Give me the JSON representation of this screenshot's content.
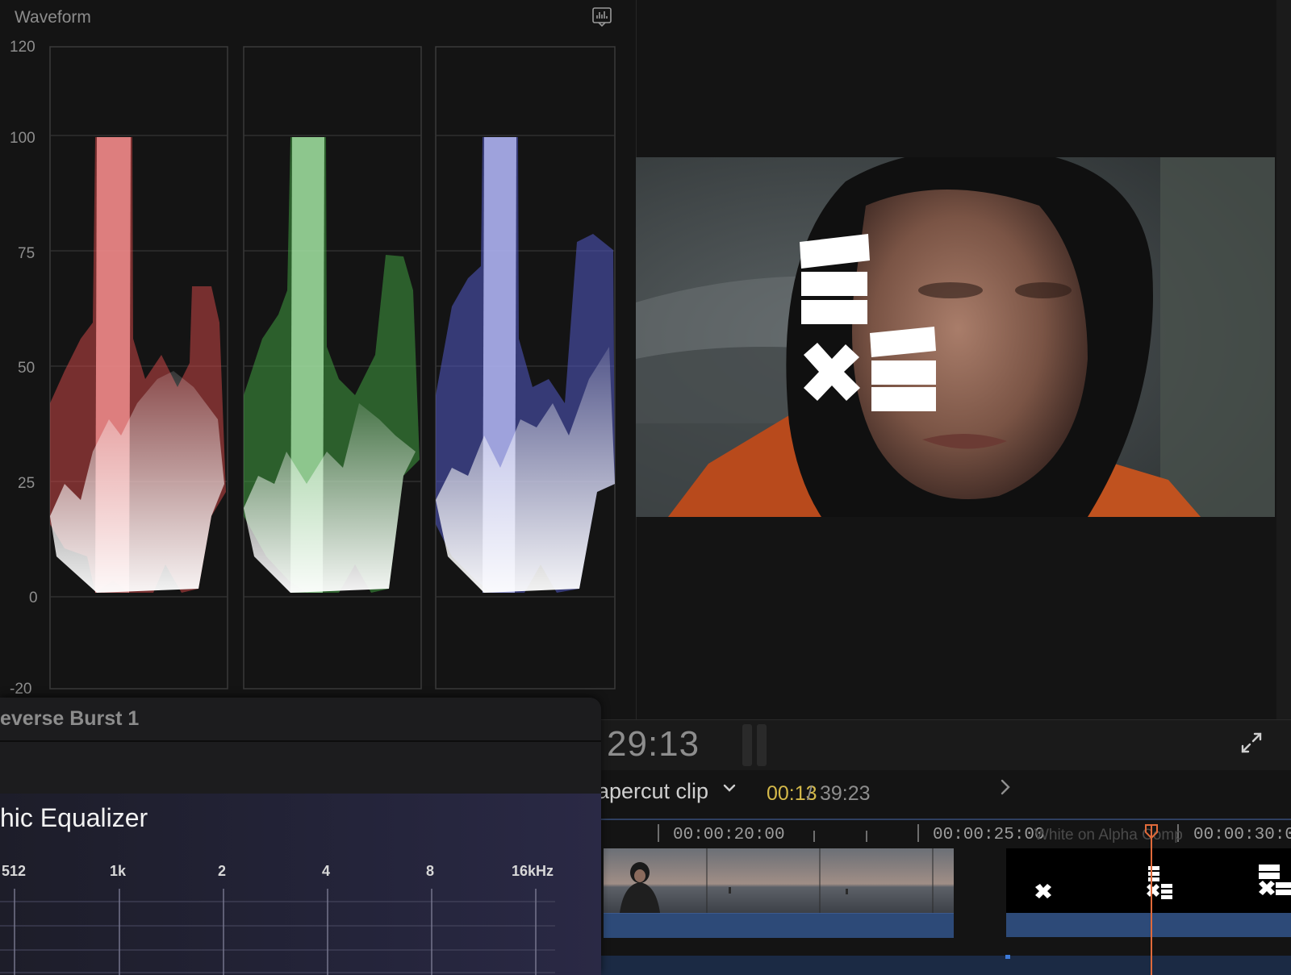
{
  "waveform": {
    "title": "Waveform",
    "icon": "waveform-settings-icon",
    "y_labels": [
      "120",
      "100",
      "75",
      "50",
      "25",
      "0",
      "-20"
    ],
    "channels": [
      {
        "name": "red",
        "color": "#e06a6a"
      },
      {
        "name": "green",
        "color": "#6fce6f"
      },
      {
        "name": "blue",
        "color": "#7a80e0"
      }
    ]
  },
  "viewer": {
    "timecode": "29:13",
    "fullscreen_icon": "fullscreen-icon"
  },
  "timeline": {
    "clip_name": "apercut clip",
    "clip_menu_icon": "chevron-down-icon",
    "current": "00:13",
    "separator": "/",
    "total": "39:23",
    "next_icon": "chevron-right-icon",
    "ruler": [
      "00:00:20:00",
      "00:00:25:00",
      "00:00:30:00"
    ],
    "ghost_title": "White on Alpha Comp",
    "playhead_color": "#e06a3a"
  },
  "effects": {
    "title": "everse Burst 1",
    "eq_title": "hic Equalizer",
    "eq_labels": [
      "512",
      "1k",
      "2",
      "4",
      "8",
      "16kHz"
    ]
  }
}
